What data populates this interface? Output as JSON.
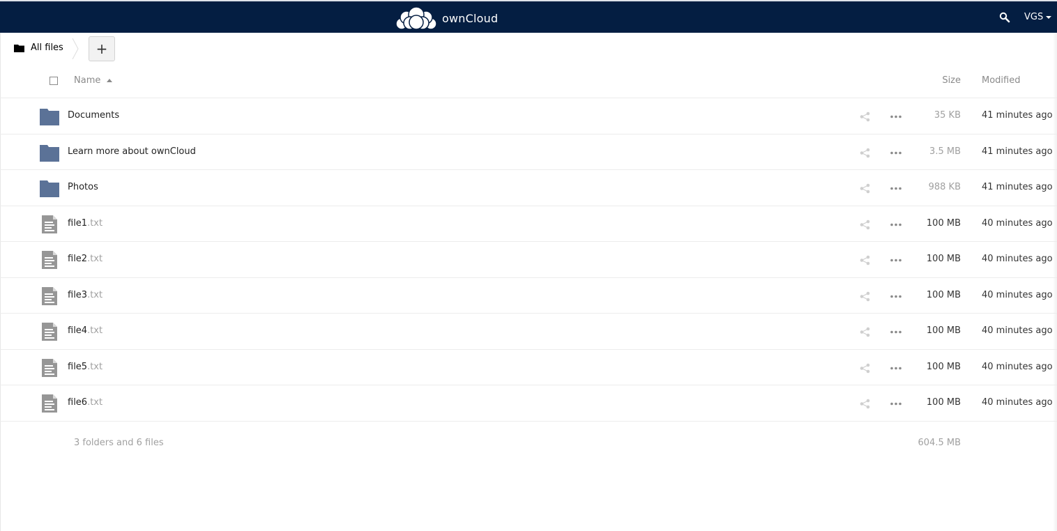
{
  "header": {
    "app_name": "ownCloud",
    "user": "VGS",
    "brand_color": "#041e42"
  },
  "breadcrumb": {
    "home_label": "All files"
  },
  "controls": {
    "new_label": "+"
  },
  "table": {
    "columns": {
      "name": "Name",
      "size": "Size",
      "modified": "Modified"
    },
    "rows": [
      {
        "name": "Documents",
        "ext": "",
        "type": "folder",
        "size": "35 KB",
        "modified": "41 minutes ago"
      },
      {
        "name": "Learn more about ownCloud",
        "ext": "",
        "type": "folder",
        "size": "3.5 MB",
        "modified": "41 minutes ago"
      },
      {
        "name": "Photos",
        "ext": "",
        "type": "folder",
        "size": "988 KB",
        "modified": "41 minutes ago"
      },
      {
        "name": "file1",
        "ext": ".txt",
        "type": "file",
        "size": "100 MB",
        "modified": "40 minutes ago"
      },
      {
        "name": "file2",
        "ext": ".txt",
        "type": "file",
        "size": "100 MB",
        "modified": "40 minutes ago"
      },
      {
        "name": "file3",
        "ext": ".txt",
        "type": "file",
        "size": "100 MB",
        "modified": "40 minutes ago"
      },
      {
        "name": "file4",
        "ext": ".txt",
        "type": "file",
        "size": "100 MB",
        "modified": "40 minutes ago"
      },
      {
        "name": "file5",
        "ext": ".txt",
        "type": "file",
        "size": "100 MB",
        "modified": "40 minutes ago"
      },
      {
        "name": "file6",
        "ext": ".txt",
        "type": "file",
        "size": "100 MB",
        "modified": "40 minutes ago"
      }
    ]
  },
  "summary": {
    "text": "3 folders and 6 files",
    "total_size": "604.5 MB"
  },
  "colors": {
    "folder": "#5b7297",
    "file_icon": "#969696",
    "small_size": "#a0a0a0",
    "large_size": "#333333"
  }
}
